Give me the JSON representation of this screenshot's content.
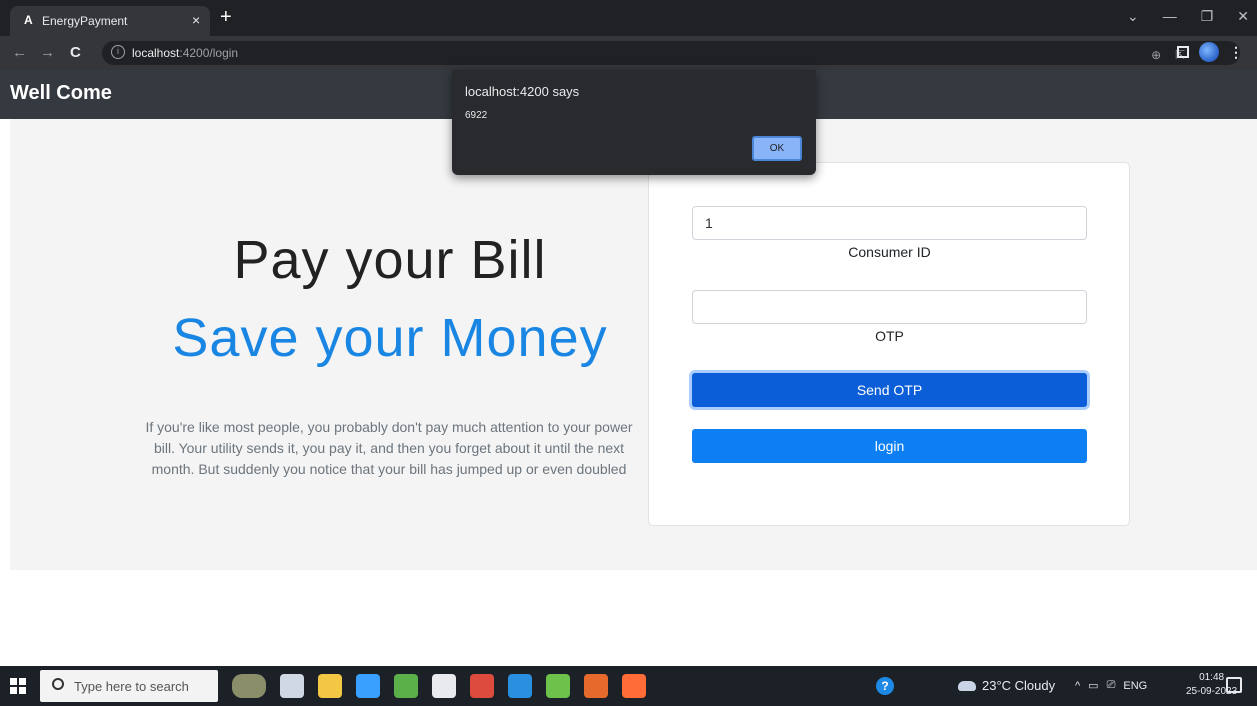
{
  "browser": {
    "tab_title": "EnergyPayment",
    "tab_favicon": "A",
    "close_glyph": "×",
    "new_tab_glyph": "+",
    "url_host": "localhost",
    "url_path": ":4200/login",
    "back_glyph": "←",
    "forward_glyph": "→",
    "reload_glyph": "C",
    "info_glyph": "i",
    "window_controls": [
      "⌄",
      "—",
      "❐",
      "✕"
    ]
  },
  "navbar": {
    "brand": "Well Come"
  },
  "hero": {
    "headline_line1": "Pay your Bill",
    "headline_line2": "Save your Money",
    "description": "If you're like most people, you probably don't pay much attention to your power bill. Your utility sends it, you pay it, and then you forget about it until the next month. But suddenly you notice that your bill has jumped up or even doubled"
  },
  "login_form": {
    "consumer_id_value": "1",
    "consumer_id_label": "Consumer ID",
    "otp_value": "",
    "otp_label": "OTP",
    "send_otp_label": "Send OTP",
    "login_label": "login"
  },
  "alert": {
    "title": "localhost:4200 says",
    "message": "6922",
    "ok_label": "OK"
  },
  "taskbar": {
    "search_placeholder": "Type here to search",
    "weather": "23°C  Cloudy",
    "language": "ENG",
    "time": "01:48",
    "date": "25-09-2023",
    "app_icons": [
      "gorilla-app-icon",
      "task-view-icon",
      "file-explorer-icon",
      "power-automate-icon",
      "eclipse-icon",
      "terminal-icon",
      "chrome-icon",
      "vscode-icon",
      "spring-tool-icon",
      "chrome-alt-icon",
      "postman-icon"
    ],
    "app_colors": [
      "#8a8f6a",
      "#cfd8e3",
      "#f2c744",
      "#3aa0ff",
      "#5bb04a",
      "#e8eaed",
      "#dd4b3e",
      "#2b8fe0",
      "#6cc24a",
      "#e66a2c",
      "#ff6c37"
    ],
    "tray_glyphs": [
      "^",
      "▭",
      "⎚"
    ],
    "help_glyph": "?"
  },
  "colors": {
    "accent_blue": "#1a86e3",
    "navbar_bg": "#343a40",
    "send_otp_bg": "#0b5ed7",
    "login_bg": "#0d7ff2"
  }
}
